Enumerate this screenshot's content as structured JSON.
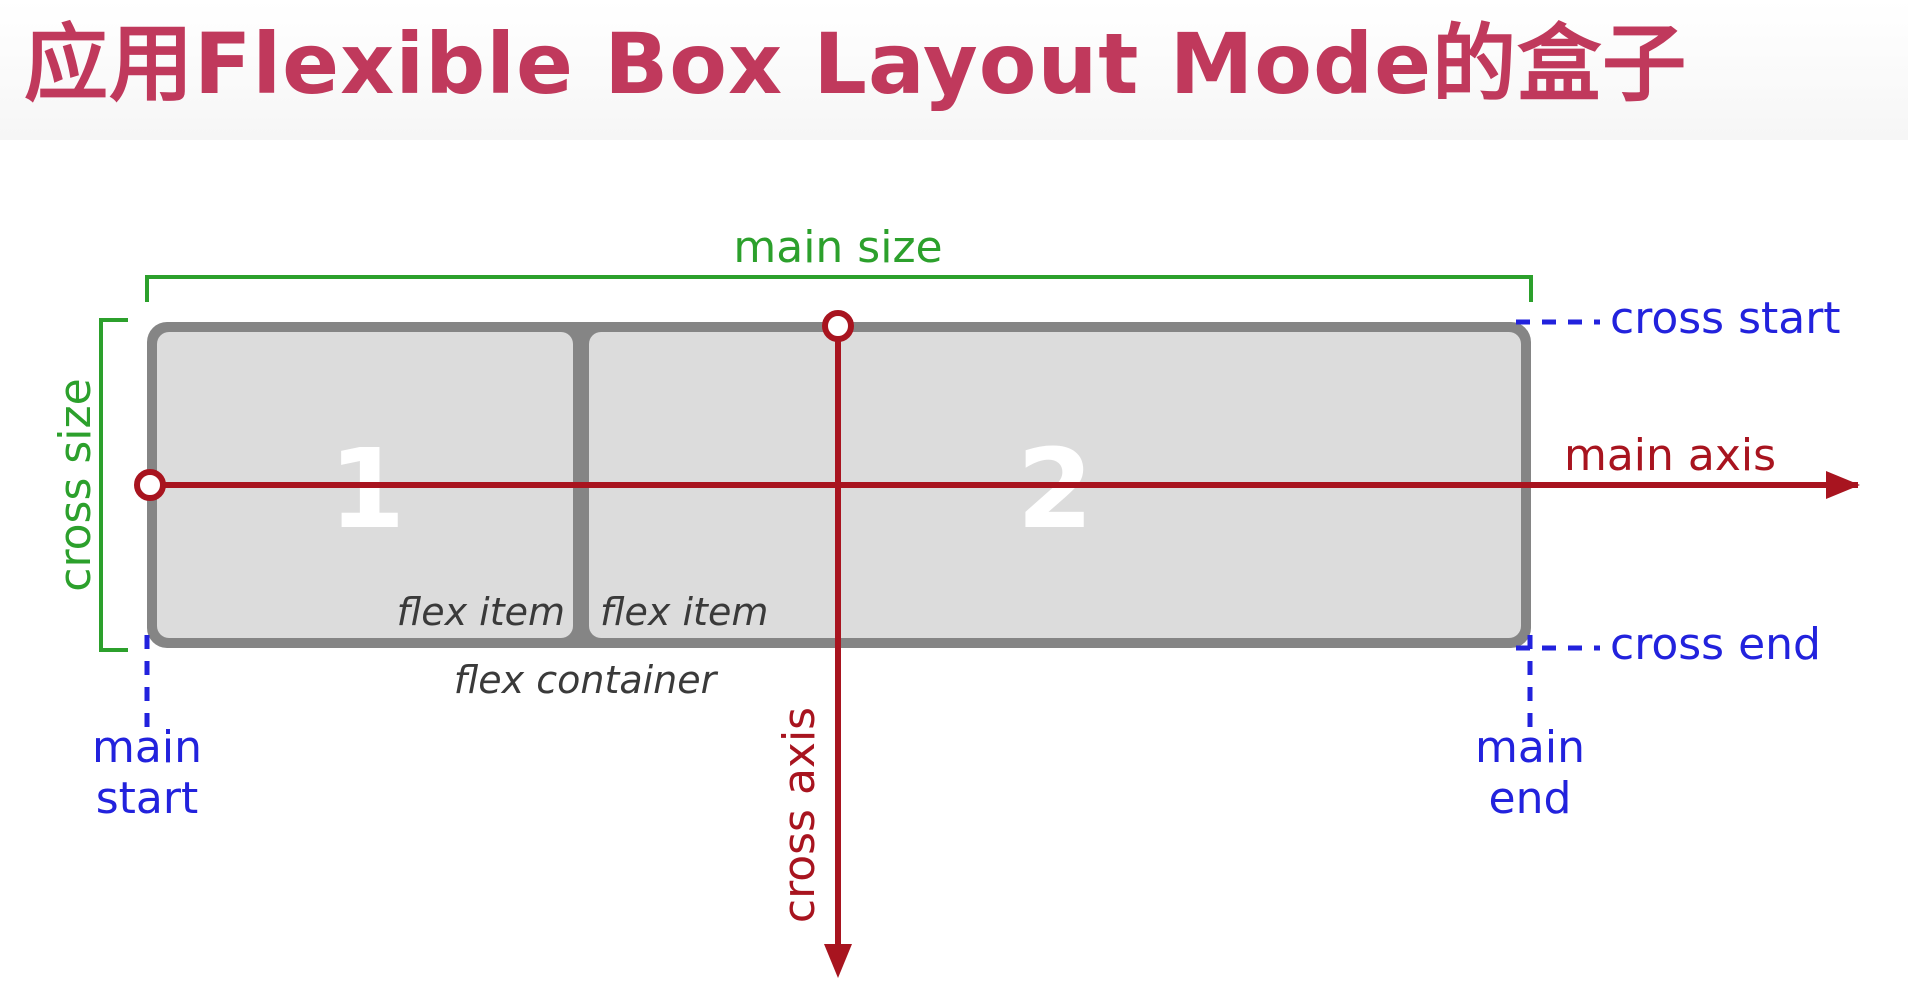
{
  "title": "应用Flexible Box Layout Mode的盒子",
  "colors": {
    "title": "#c0395c",
    "size_labels": "#2ca02c",
    "position_labels": "#2222dd",
    "axes": "#a8141f",
    "container_border": "#858585",
    "item_fill": "#dcdcdc"
  },
  "diagram": {
    "main_size": "main size",
    "cross_size": "cross size",
    "cross_start": "cross start",
    "cross_end": "cross end",
    "main_axis": "main axis",
    "cross_axis": "cross axis",
    "main_start_line1": "main",
    "main_start_line2": "start",
    "main_end_line1": "main",
    "main_end_line2": "end",
    "flex_container": "flex container",
    "items": [
      {
        "number": "1",
        "label": "flex item"
      },
      {
        "number": "2",
        "label": "flex item"
      }
    ]
  }
}
